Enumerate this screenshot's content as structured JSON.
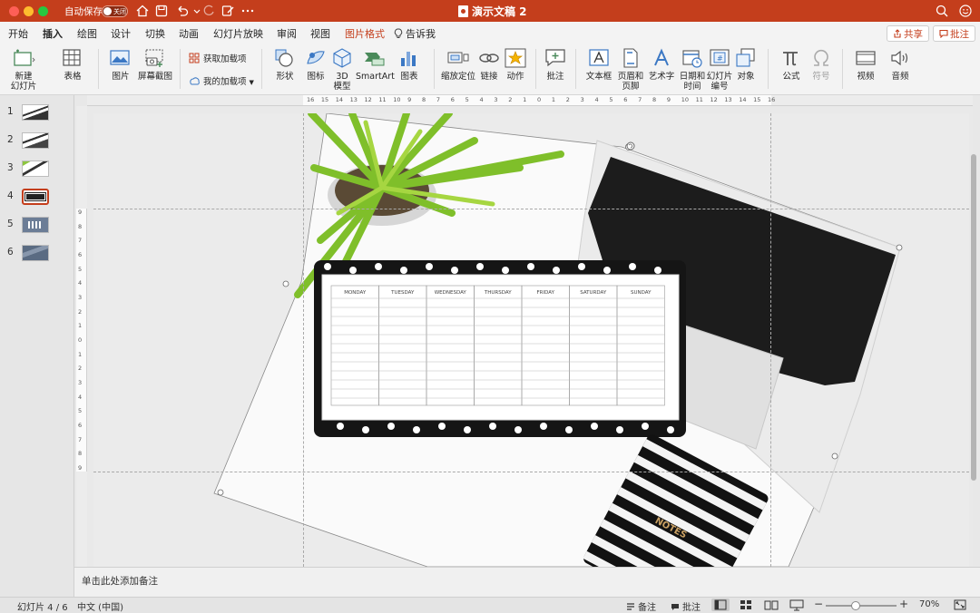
{
  "titlebar": {
    "autosave_label": "自动保存",
    "autosave_state": "关闭",
    "doc_title": "演示文稿 2",
    "icons": [
      "home-icon",
      "save-icon",
      "undo-icon",
      "redo-icon",
      "edit-icon",
      "more-icon",
      "search-icon",
      "smiley-icon"
    ]
  },
  "tabs": {
    "items": [
      "开始",
      "插入",
      "绘图",
      "设计",
      "切换",
      "动画",
      "幻灯片放映",
      "审阅",
      "视图",
      "图片格式",
      "告诉我"
    ],
    "active": "插入",
    "context": "图片格式",
    "share": "共享",
    "comment": "批注"
  },
  "ribbon": {
    "new_slide": "新建\n幻灯片",
    "table": "表格",
    "picture": "图片",
    "screenshot": "屏幕截图",
    "get_addins": "获取加载项",
    "my_addins": "我的加载项",
    "shapes": "形状",
    "icons": "图标",
    "model3d": "3D\n模型",
    "smartart": "SmartArt",
    "chart": "图表",
    "zoom": "缩放定位",
    "link": "链接",
    "action": "动作",
    "comment": "批注",
    "textbox": "文本框",
    "header_footer": "页眉和\n页脚",
    "wordart": "艺术字",
    "datetime": "日期和\n时间",
    "slide_number": "幻灯片\n编号",
    "object": "对象",
    "equation": "公式",
    "symbol": "符号",
    "video": "视频",
    "audio": "音频"
  },
  "ruler": {
    "h_ticks": [
      "16",
      "15",
      "14",
      "13",
      "12",
      "11",
      "10",
      "9",
      "8",
      "7",
      "6",
      "5",
      "4",
      "3",
      "2",
      "1",
      "0",
      "1",
      "2",
      "3",
      "4",
      "5",
      "6",
      "7",
      "8",
      "9",
      "10",
      "11",
      "12",
      "13",
      "14",
      "15",
      "16"
    ],
    "v_ticks": [
      "9",
      "8",
      "7",
      "6",
      "5",
      "4",
      "3",
      "2",
      "1",
      "0",
      "1",
      "2",
      "3",
      "4",
      "5",
      "6",
      "7",
      "8",
      "9"
    ]
  },
  "thumbnails": [
    "1",
    "2",
    "3",
    "4",
    "5",
    "6"
  ],
  "selected_slide": "4",
  "planner": {
    "days": [
      "MONDAY",
      "TUESDAY",
      "WEDNESDAY",
      "THURSDAY",
      "FRIDAY",
      "SATURDAY",
      "SUNDAY"
    ],
    "notebook": "NOTES"
  },
  "notes_placeholder": "单击此处添加备注",
  "status": {
    "slide_pos": "幻灯片 4 / 6",
    "language": "中文 (中国)",
    "notes": "备注",
    "comments": "批注",
    "zoom": "70%",
    "zoom_fraction": 0.42
  }
}
